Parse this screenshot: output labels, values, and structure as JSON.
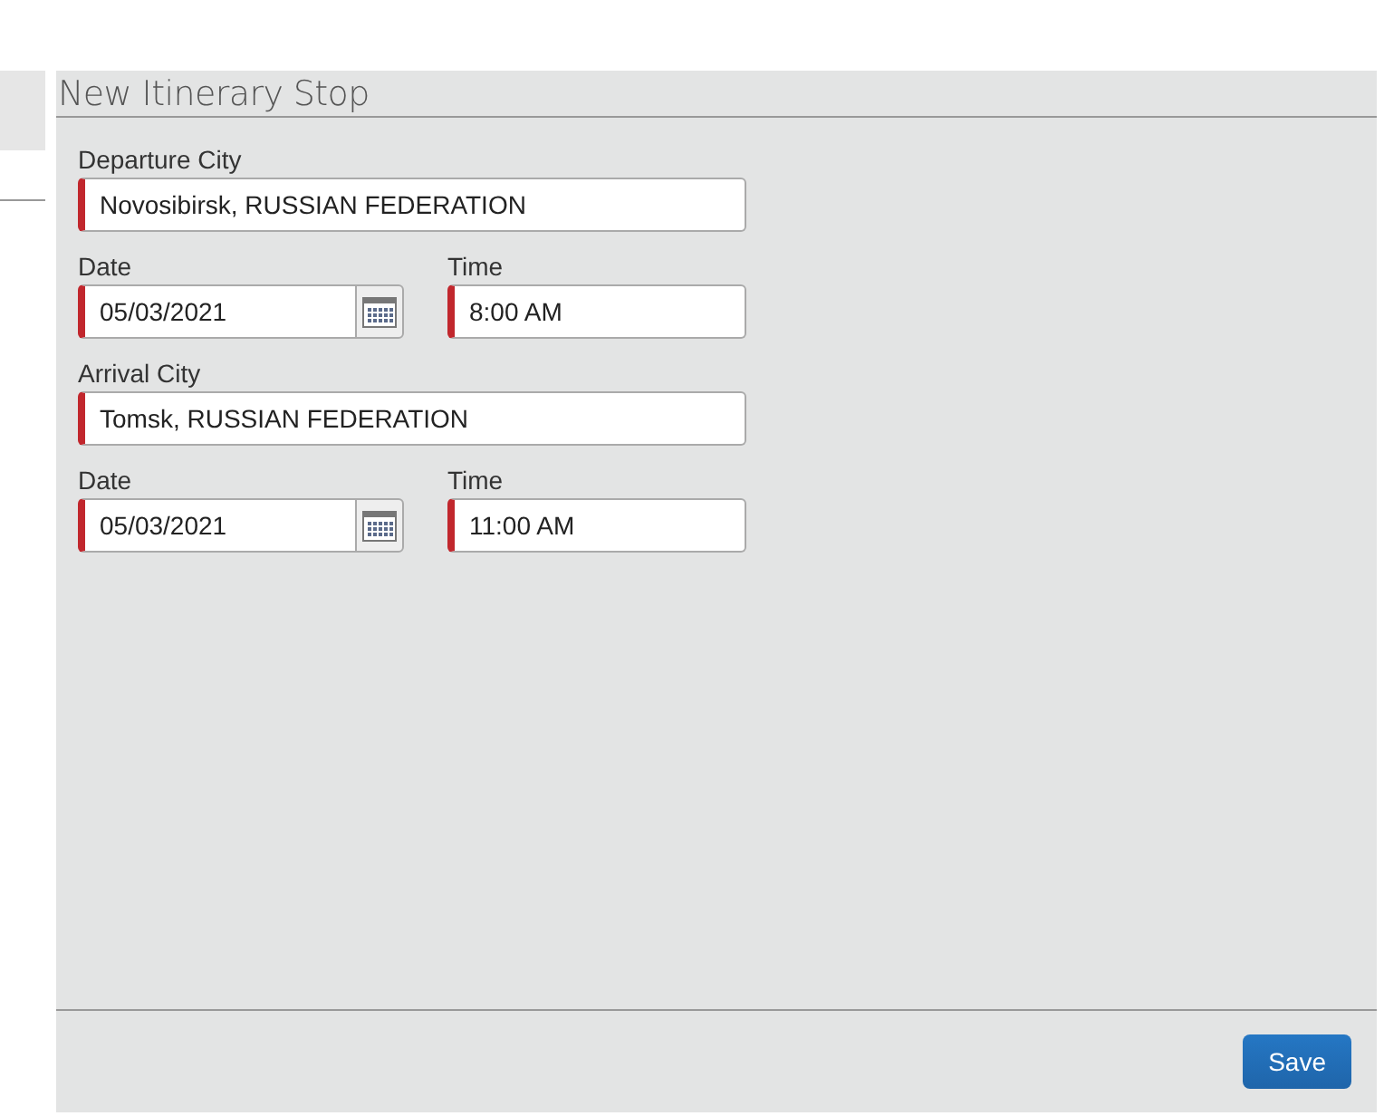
{
  "dialog": {
    "title": "New Itinerary Stop"
  },
  "rows": [
    {
      "kind": "text",
      "label": "Departure City",
      "value": "Novosibirsk, RUSSIAN FEDERATION",
      "required": true
    },
    {
      "kind": "datetime",
      "date": {
        "label": "Date",
        "value": "05/03/2021",
        "required": true
      },
      "time": {
        "label": "Time",
        "value": "8:00 AM",
        "required": true
      }
    },
    {
      "kind": "text",
      "label": "Arrival City",
      "value": "Tomsk, RUSSIAN FEDERATION",
      "required": true
    },
    {
      "kind": "datetime",
      "date": {
        "label": "Date",
        "value": "05/03/2021",
        "required": true
      },
      "time": {
        "label": "Time",
        "value": "11:00 AM",
        "required": true
      }
    }
  ],
  "buttons": [
    {
      "label": "Save"
    }
  ]
}
